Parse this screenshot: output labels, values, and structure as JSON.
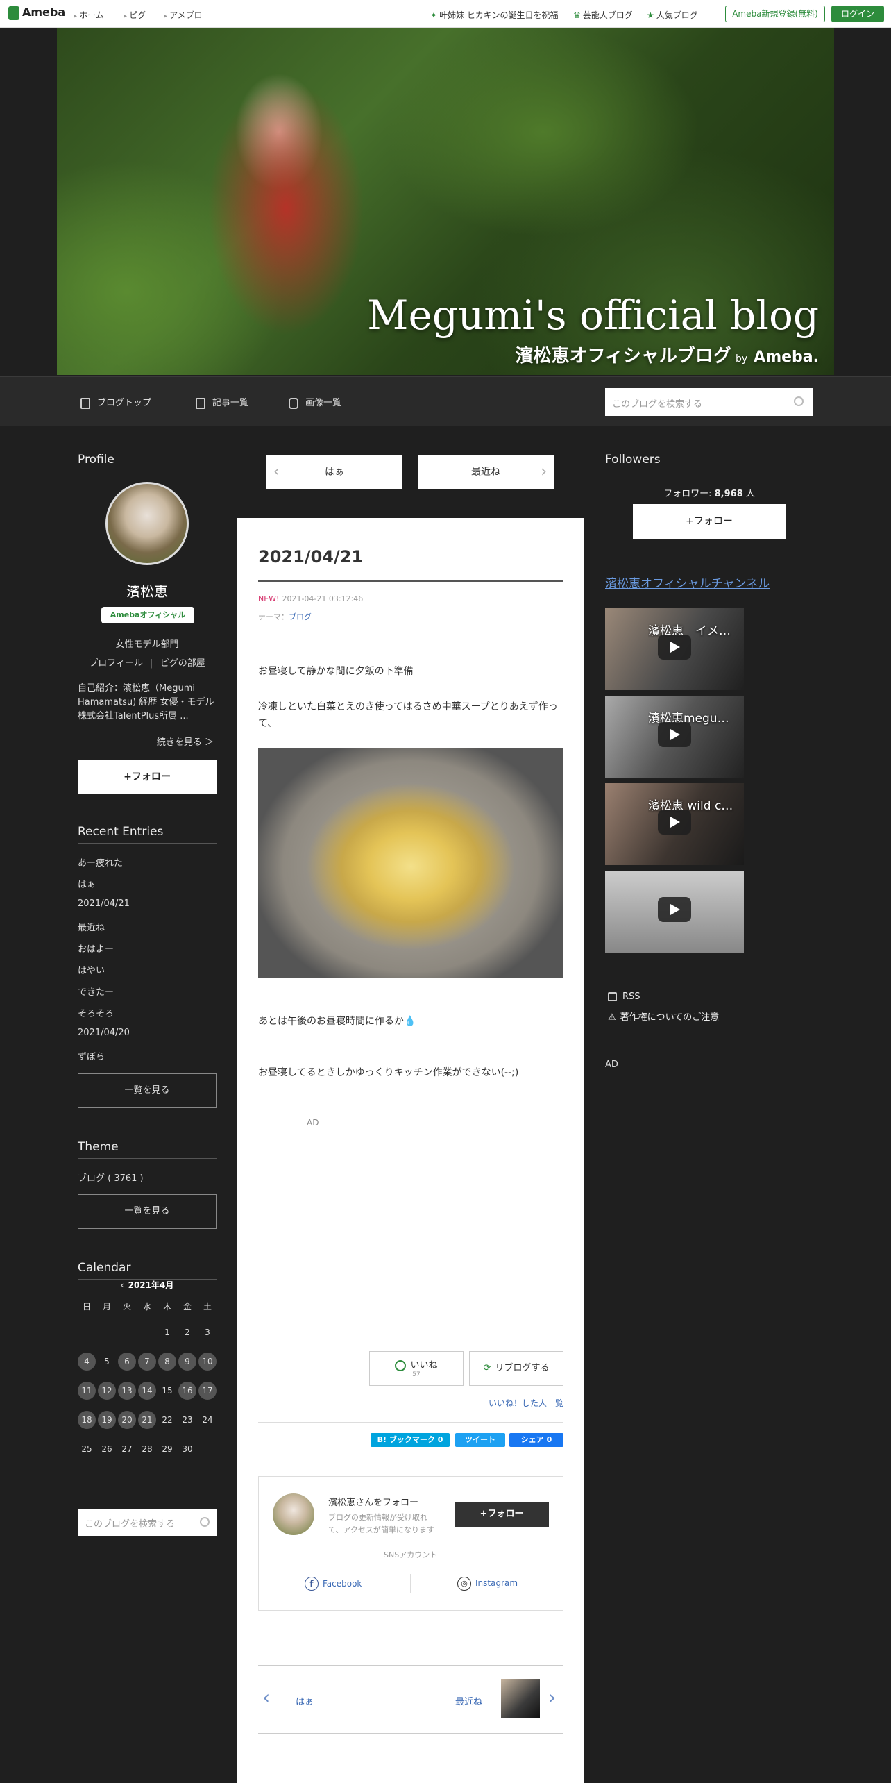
{
  "topbar": {
    "logo": "Ameba",
    "nav": [
      "ホーム",
      "ピグ",
      "アメブロ"
    ],
    "links": [
      "叶姉妹 ヒカキンの誕生日を祝福",
      "芸能人ブログ",
      "人気ブログ"
    ],
    "register": "Ameba新規登録(無料)",
    "login": "ログイン"
  },
  "header": {
    "title": "Megumi's official blog",
    "subtitle": "濱松恵オフィシャルブログ",
    "by": "by",
    "ameba": "Ameba."
  },
  "blognav": {
    "items": [
      "ブログトップ",
      "記事一覧",
      "画像一覧"
    ],
    "search_placeholder": "このブログを検索する"
  },
  "profile": {
    "heading": "Profile",
    "name": "濱松恵",
    "badge": "Amebaオフィシャル",
    "category": "女性モデル部門",
    "link_profile": "プロフィール",
    "link_pig": "ピグの部屋",
    "intro": "自己紹介：濱松恵（Megumi Hamamatsu) 経歴 女優・モデル 株式会社TalentPlus所属 ...",
    "more": "続きを見る ＞",
    "follow": "+フォロー"
  },
  "recent": {
    "heading": "Recent Entries",
    "items": [
      "あー疲れた",
      "はぁ",
      "2021/04/21",
      "最近ね",
      "おはよー",
      "はやい",
      "できたー",
      "そろそろ",
      "2021/04/20",
      "ずぼら"
    ],
    "see_all": "一覧を見る"
  },
  "theme": {
    "heading": "Theme",
    "item": "ブログ ( 3761 )",
    "see_all": "一覧を見る"
  },
  "calendar": {
    "heading": "Calendar",
    "month": "2021年4月",
    "weekdays": [
      "日",
      "月",
      "火",
      "水",
      "木",
      "金",
      "土"
    ],
    "days": [
      "1",
      "2",
      "3",
      "4",
      "5",
      "6",
      "7",
      "8",
      "9",
      "10",
      "11",
      "12",
      "13",
      "14",
      "15",
      "16",
      "17",
      "18",
      "19",
      "20",
      "21",
      "22",
      "23",
      "24",
      "25",
      "26",
      "27",
      "28",
      "29",
      "30"
    ],
    "post_days": [
      4,
      6,
      7,
      8,
      9,
      10,
      11,
      12,
      13,
      14,
      16,
      17,
      18,
      19,
      20,
      21
    ]
  },
  "left_search": "このブログを検索する",
  "pager": {
    "prev": "はぁ",
    "next": "最近ね"
  },
  "article": {
    "title": "2021/04/21",
    "new_label": "NEW!",
    "datetime": "2021-04-21 03:12:46",
    "theme_label": "テーマ：",
    "theme": "ブログ",
    "p1": "お昼寝して静かな間に夕飯の下準備",
    "p2": "冷凍しといた白菜とえのき使ってはるさめ中華スープとりあえず作って、",
    "p3": "あとは午後のお昼寝時間に作るか💧",
    "p4": "お昼寝してるときしかゆっくりキッチン作業ができない(--;)",
    "ad": "AD",
    "like": "いいね",
    "like_count": "57",
    "reblog": "リブログする",
    "liked_list": "いいね！した人一覧",
    "share": {
      "hatena": "B! ブックマーク 0",
      "tweet": "ツイート",
      "fb": "シェア 0"
    },
    "follow_card": {
      "title": "濱松恵さんをフォロー",
      "desc": "ブログの更新情報が受け取れて、アクセスが簡単になります",
      "button": "+フォロー",
      "sns_label": "SNSアカウント",
      "facebook": "Facebook",
      "instagram": "Instagram"
    },
    "bottom_prev": "はぁ",
    "bottom_next": "最近ね"
  },
  "right": {
    "followers_heading": "Followers",
    "follower_label": "フォロワー:",
    "follower_count": "8,968",
    "follower_unit": "人",
    "follow": "+フォロー",
    "channel_link": "濱松恵オフィシャルチャンネル",
    "videos": [
      "濱松恵　イメ…",
      "濱松恵megu…",
      "濱松恵 wild c…",
      ""
    ],
    "rss": "RSS",
    "copyright": "著作権についてのご注意",
    "ad": "AD"
  }
}
